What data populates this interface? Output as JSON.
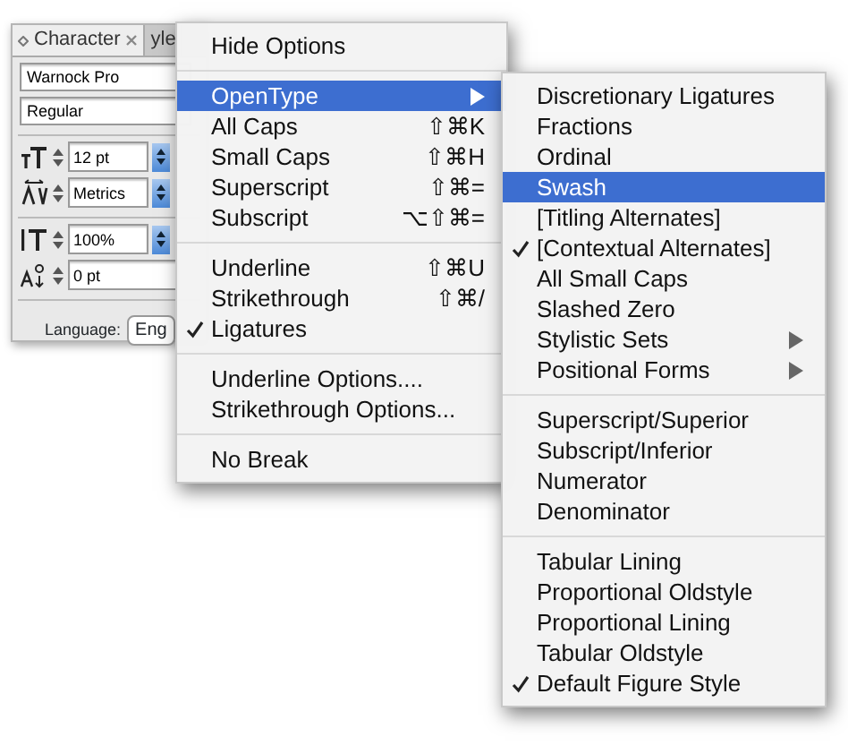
{
  "panel": {
    "tabs": [
      {
        "label": "Character",
        "selected": true
      },
      {
        "label": "yle",
        "selected": false
      }
    ],
    "font_family": "Warnock Pro",
    "font_style": "Regular",
    "fields": [
      {
        "kind": "size",
        "value": "12 pt",
        "dropdown": true
      },
      {
        "kind": "tracking",
        "value": "Metrics",
        "dropdown": true
      },
      {
        "kind": "scale",
        "value": "100%",
        "dropdown": true
      },
      {
        "kind": "baseline",
        "value": "0 pt",
        "dropdown": false
      }
    ],
    "language_label": "Language:",
    "language_value": "Eng"
  },
  "menu": {
    "sections": [
      {
        "items": [
          {
            "label": "Hide Options",
            "checked": false,
            "selected": false
          }
        ]
      },
      {
        "items": [
          {
            "label": "OpenType",
            "checked": false,
            "selected": true,
            "submenu": true
          },
          {
            "label": "All Caps",
            "shortcut": "⇧⌘K",
            "checked": false,
            "selected": false
          },
          {
            "label": "Small Caps",
            "shortcut": "⇧⌘H",
            "checked": false,
            "selected": false
          },
          {
            "label": "Superscript",
            "shortcut": "⇧⌘=",
            "checked": false,
            "selected": false
          },
          {
            "label": "Subscript",
            "shortcut": "⌥⇧⌘=",
            "checked": false,
            "selected": false
          }
        ]
      },
      {
        "items": [
          {
            "label": "Underline",
            "shortcut": "⇧⌘U",
            "checked": false,
            "selected": false
          },
          {
            "label": "Strikethrough",
            "shortcut": "⇧⌘/",
            "checked": false,
            "selected": false
          },
          {
            "label": "Ligatures",
            "checked": true,
            "selected": false
          }
        ]
      },
      {
        "items": [
          {
            "label": "Underline Options....",
            "checked": false,
            "selected": false
          },
          {
            "label": "Strikethrough Options...",
            "checked": false,
            "selected": false
          }
        ]
      },
      {
        "items": [
          {
            "label": "No Break",
            "checked": false,
            "selected": false
          }
        ]
      }
    ]
  },
  "submenu": {
    "sections": [
      {
        "items": [
          {
            "label": "Discretionary Ligatures",
            "checked": false,
            "selected": false
          },
          {
            "label": "Fractions",
            "checked": false,
            "selected": false
          },
          {
            "label": "Ordinal",
            "checked": false,
            "selected": false
          },
          {
            "label": "Swash",
            "checked": false,
            "selected": true
          },
          {
            "label": "[Titling Alternates]",
            "checked": false,
            "selected": false
          },
          {
            "label": "[Contextual Alternates]",
            "checked": true,
            "selected": false
          },
          {
            "label": "All Small Caps",
            "checked": false,
            "selected": false
          },
          {
            "label": "Slashed Zero",
            "checked": false,
            "selected": false
          },
          {
            "label": "Stylistic Sets",
            "checked": false,
            "selected": false,
            "submenu": true
          },
          {
            "label": "Positional Forms",
            "checked": false,
            "selected": false,
            "submenu": true
          }
        ]
      },
      {
        "items": [
          {
            "label": "Superscript/Superior",
            "checked": false,
            "selected": false
          },
          {
            "label": "Subscript/Inferior",
            "checked": false,
            "selected": false
          },
          {
            "label": "Numerator",
            "checked": false,
            "selected": false
          },
          {
            "label": "Denominator",
            "checked": false,
            "selected": false
          }
        ]
      },
      {
        "items": [
          {
            "label": "Tabular Lining",
            "checked": false,
            "selected": false
          },
          {
            "label": "Proportional Oldstyle",
            "checked": false,
            "selected": false
          },
          {
            "label": "Proportional Lining",
            "checked": false,
            "selected": false
          },
          {
            "label": "Tabular Oldstyle",
            "checked": false,
            "selected": false
          },
          {
            "label": "Default Figure Style",
            "checked": true,
            "selected": false
          }
        ]
      }
    ]
  }
}
